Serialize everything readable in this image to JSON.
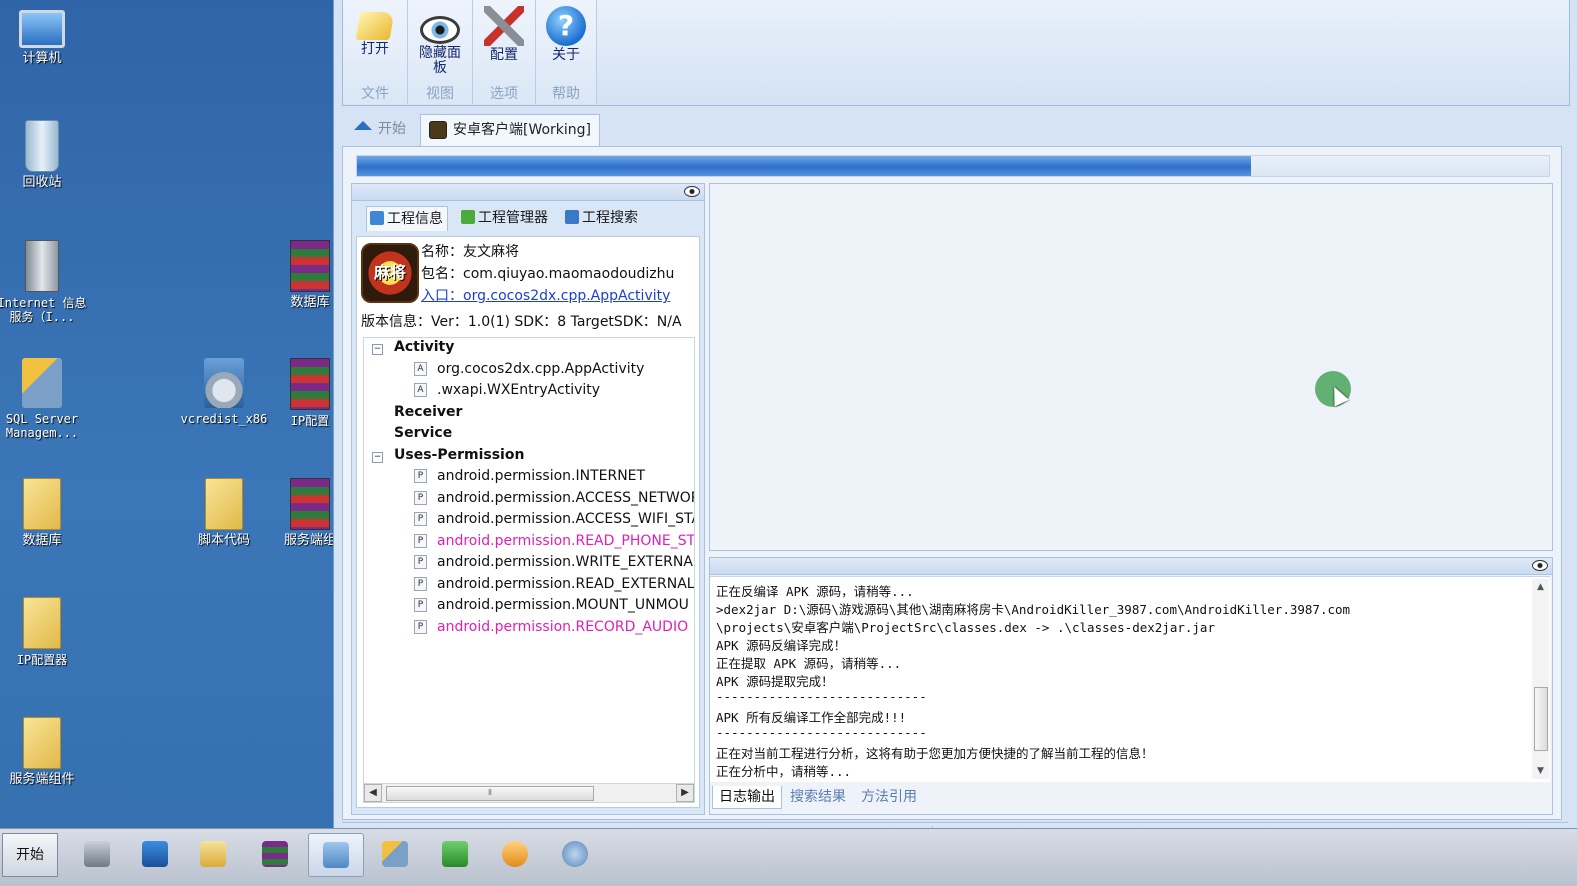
{
  "desktop": {
    "icons": {
      "computer": "计算机",
      "recycle": "回收站",
      "iis": "Internet 信息服务（I...",
      "sql": "SQL Server Managem...",
      "database": "数据库",
      "ipconf": "IP配置器",
      "service_comp": "服务端组件",
      "vcredist": "vcredist_x86",
      "script": "脚本代码",
      "rar1": "数据库",
      "rar2": "IP配置",
      "rar3": "服务端组"
    }
  },
  "ribbon": {
    "groups": [
      {
        "button": "打开",
        "name": "文件"
      },
      {
        "button": "隐藏面板",
        "name": "视图"
      },
      {
        "button": "配置",
        "name": "选项"
      },
      {
        "button": "关于",
        "name": "帮助"
      }
    ]
  },
  "doc_tabs": {
    "start": "开始",
    "project": "安卓客户端[Working]"
  },
  "progress": {
    "value": 0.75
  },
  "left_panel": {
    "subtabs": [
      "工程信息",
      "工程管理器",
      "工程搜索"
    ],
    "icon_text": "麻将",
    "name_line": "名称：友文麻将",
    "package_line": "包名：com.qiuyao.maomaodoudizhu",
    "entry_line": "入口：org.cocos2dx.cpp.AppActivity",
    "version_line": "版本信息：Ver：1.0(1) SDK：8 TargetSDK：N/A",
    "tree": {
      "activity": "Activity",
      "activity_items": [
        "org.cocos2dx.cpp.AppActivity",
        ".wxapi.WXEntryActivity"
      ],
      "receiver": "Receiver",
      "service": "Service",
      "uses_permission": "Uses-Permission",
      "permissions": [
        "android.permission.INTERNET",
        "android.permission.ACCESS_NETWOR",
        "android.permission.ACCESS_WIFI_STA",
        "android.permission.READ_PHONE_ST",
        "android.permission.WRITE_EXTERNA",
        "android.permission.READ_EXTERNAL",
        "android.permission.MOUNT_UNMOU",
        "android.permission.RECORD_AUDIO"
      ],
      "leaf_activity_mark": "A",
      "leaf_permission_mark": "P",
      "expand_mark": "−"
    }
  },
  "log": {
    "lines": [
      "正在反编译 APK 源码，请稍等...",
      ">dex2jar D:\\源码\\游戏源码\\其他\\湖南麻将房卡\\AndroidKiller_3987.com\\AndroidKiller.3987.com",
      "\\projects\\安卓客户端\\ProjectSrc\\classes.dex -> .\\classes-dex2jar.jar",
      "APK 源码反编译完成！",
      "正在提取 APK 源码，请稍等...",
      "APK 源码提取完成！",
      "----------------------------",
      "APK 所有反编译工作全部完成!!!",
      "----------------------------",
      "正在对当前工程进行分析，这将有助于您更加方便快捷的了解当前工程的信息！",
      "正在分析中，请稍等..."
    ],
    "tabs": [
      "日志输出",
      "搜索结果",
      "方法引用"
    ]
  },
  "taskbar": {
    "start": "开始"
  },
  "colors": {
    "highlight_permission": "#e020b4",
    "link": "#1a3fd6",
    "progress": "#2e6fcb"
  }
}
